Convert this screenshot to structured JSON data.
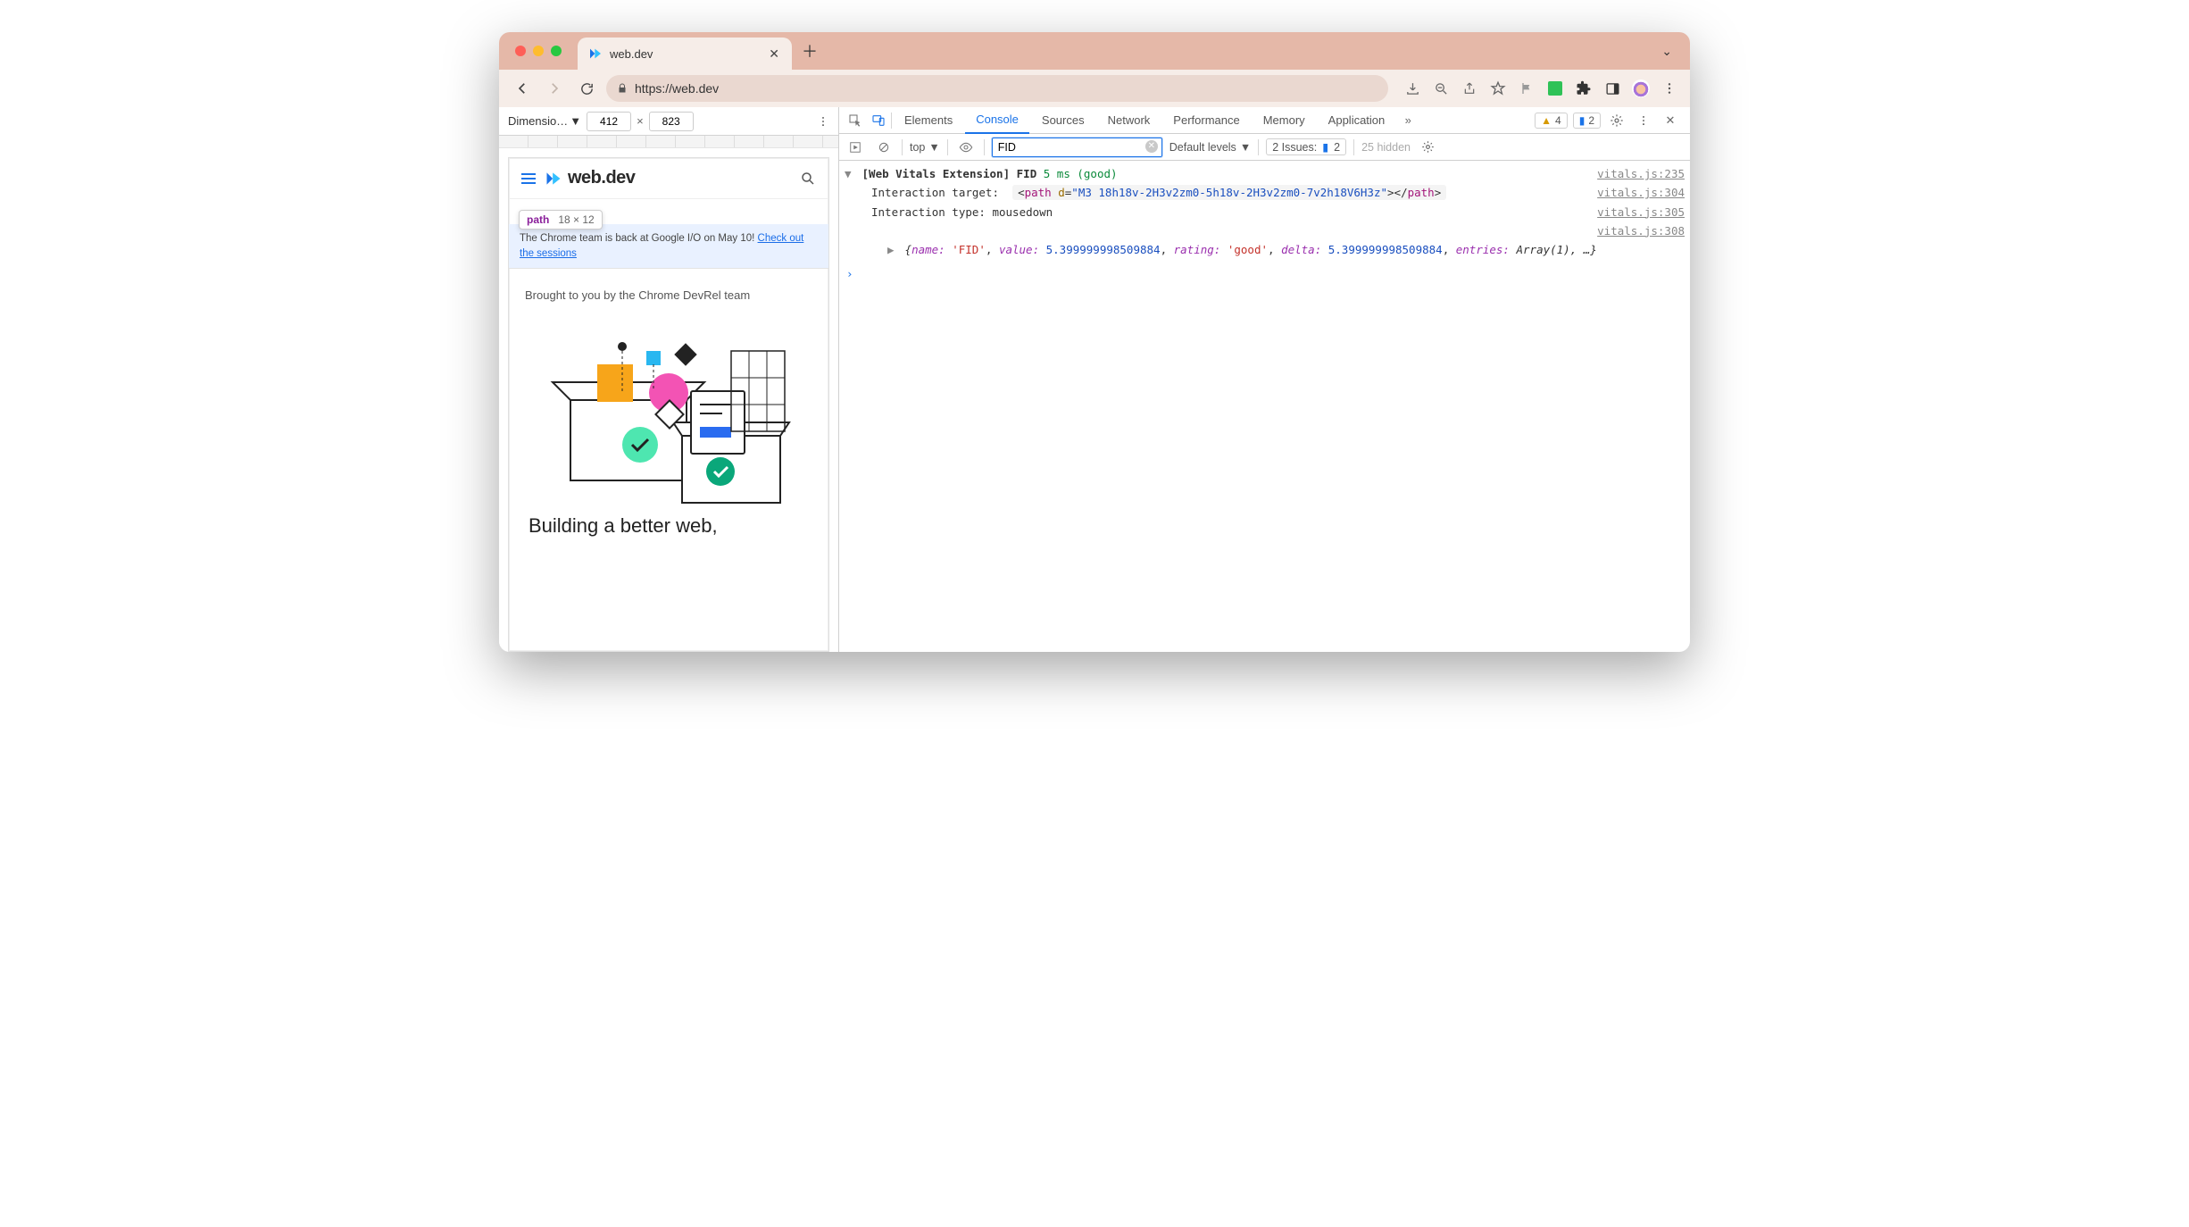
{
  "browser": {
    "tab_title": "web.dev",
    "url_display": "https://web.dev",
    "traffic": [
      "red",
      "yel",
      "grn"
    ]
  },
  "device_toolbar": {
    "label": "Dimensio…",
    "width": "412",
    "height": "823",
    "x": "×"
  },
  "preview": {
    "brand": "web.dev",
    "tooltip_el": "path",
    "tooltip_dims": "18 × 12",
    "banner_prefix": "The Chrome team is back at Google I/O on May 10! ",
    "banner_link": "Check out the sessions",
    "devrel": "Brought to you by the Chrome DevRel team",
    "headline": "Building a better web,"
  },
  "devtools": {
    "tabs": [
      "Elements",
      "Console",
      "Sources",
      "Network",
      "Performance",
      "Memory",
      "Application"
    ],
    "active_tab": "Console",
    "warn_count": "4",
    "msg_count": "2",
    "context": "top",
    "filter_value": "FID",
    "levels_label": "Default levels",
    "issues_label": "2 Issues:",
    "issues_count": "2",
    "hidden_label": "25 hidden"
  },
  "console": {
    "line1_prefix": "[Web Vitals Extension]",
    "line1_metric": "FID",
    "line1_value": "5 ms (good)",
    "line1_src": "vitals.js:235",
    "line2_label": "Interaction target:",
    "line2_html_tag": "path",
    "line2_html_attr": "d",
    "line2_html_val": "\"M3 18h18v-2H3v2zm0-5h18v-2H3v2zm0-7v2h18V6H3z\"",
    "line2_src": "vitals.js:304",
    "line3_label": "Interaction type:",
    "line3_value": "mousedown",
    "line3_src": "vitals.js:305",
    "line4_src": "vitals.js:308",
    "obj_name_k": "name:",
    "obj_name_v": "'FID'",
    "obj_value_k": "value:",
    "obj_value_v": "5.399999998509884",
    "obj_rating_k": "rating:",
    "obj_rating_v": "'good'",
    "obj_delta_k": "delta:",
    "obj_delta_v": "5.399999998509884",
    "obj_entries_k": "entries:",
    "obj_entries_v": "Array(1)",
    "obj_tail": ", …}"
  }
}
